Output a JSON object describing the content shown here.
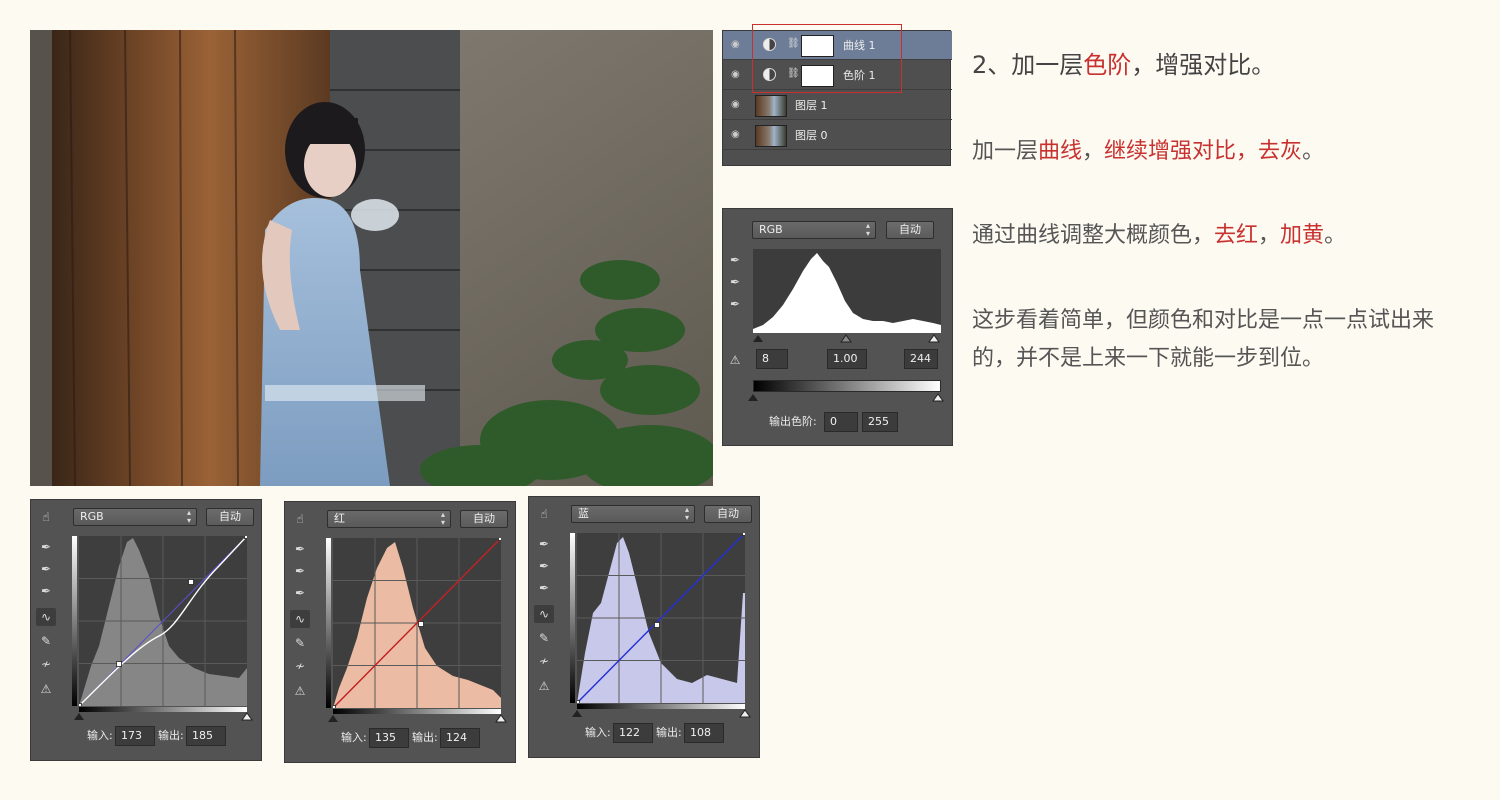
{
  "layers_panel": {
    "rows": [
      {
        "name": "曲线 1",
        "type": "adjustment",
        "selected": true
      },
      {
        "name": "色阶 1",
        "type": "adjustment",
        "selected": false
      },
      {
        "name": "图层 1",
        "type": "image",
        "selected": false
      },
      {
        "name": "图层 0",
        "type": "image",
        "selected": false
      }
    ],
    "icons": {
      "eye": "eye-icon",
      "link": "chain-link-icon"
    }
  },
  "levels_panel": {
    "channel": "RGB",
    "auto_label": "自动",
    "input_black": "8",
    "input_gamma": "1.00",
    "input_white": "244",
    "output_label": "输出色阶:",
    "output_black": "0",
    "output_white": "255"
  },
  "curves_panels": [
    {
      "channel": "RGB",
      "auto_label": "自动",
      "input_label": "输入:",
      "input": "173",
      "output_label": "输出:",
      "output": "185",
      "curve_color": "#ffffff",
      "hist_fill": "#8a8a8a"
    },
    {
      "channel": "红",
      "auto_label": "自动",
      "input_label": "输入:",
      "input": "135",
      "output_label": "输出:",
      "output": "124",
      "curve_color": "#c42020",
      "hist_fill": "#f6c2aa"
    },
    {
      "channel": "蓝",
      "auto_label": "自动",
      "input_label": "输入:",
      "input": "122",
      "output_label": "输出:",
      "output": "108",
      "curve_color": "#2430d8",
      "hist_fill": "#d0d0f4"
    }
  ],
  "instructions": {
    "line1_prefix": "2、加一层",
    "line1_red": "色阶",
    "line1_suffix": "，增强对比。",
    "line2_prefix": "加一层",
    "line2_red1": "曲线",
    "line2_sep": "，",
    "line2_red2": "继续增强对比，去灰",
    "line2_suffix": "。",
    "line3_prefix": "通过曲线调整大概颜色，",
    "line3_red1": "去红",
    "line3_sep": "，",
    "line3_red2": "加黄",
    "line3_suffix": "。",
    "line4": "这步看着简单，但颜色和对比是一点一点试出来的，并不是上来一下就能一步到位。"
  },
  "colors": {
    "accent_red": "#c8312f",
    "panel_bg": "#535353",
    "page_bg": "#fdfaf2"
  }
}
